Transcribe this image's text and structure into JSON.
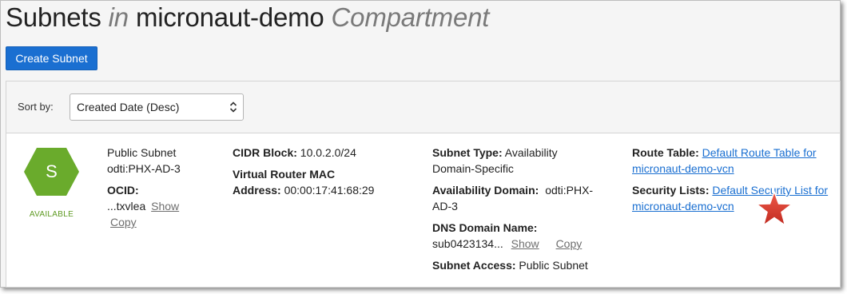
{
  "header": {
    "title_part1": "Subnets",
    "title_in": "in",
    "title_compartment_name": "micronaut-demo",
    "title_compartment_word": "Compartment"
  },
  "toolbar": {
    "create_label": "Create Subnet"
  },
  "sort": {
    "label": "Sort by:",
    "selected": "Created Date (Desc)"
  },
  "subnet": {
    "avatar_letter": "S",
    "state": "AVAILABLE",
    "name": "Public Subnet",
    "availability_domain_short": "odti:PHX-AD-3",
    "ocid_label": "OCID:",
    "ocid_value": "...txvlea",
    "show_label": "Show",
    "copy_label": "Copy",
    "cidr_label": "CIDR Block:",
    "cidr_value": "10.0.2.0/24",
    "vr_mac_label_1": "Virtual Router MAC",
    "vr_mac_label_2": "Address:",
    "vr_mac_value": "00:00:17:41:68:29",
    "subnet_type_label": "Subnet Type:",
    "subnet_type_value_1": "Availability",
    "subnet_type_value_2": "Domain-Specific",
    "ad_label": "Availability Domain:",
    "ad_value_1": "odti:PHX-",
    "ad_value_2": "AD-3",
    "dns_label": "DNS Domain Name:",
    "dns_value": "sub0423134...",
    "subnet_access_label": "Subnet Access:",
    "subnet_access_value": "Public Subnet",
    "route_table_label": "Route Table:",
    "route_table_link_1": "Default Route Table for",
    "route_table_link_2": "micronaut-demo-vcn",
    "security_lists_label": "Security Lists:",
    "security_list_link_1": "Default Security List for",
    "security_list_link_2": "micronaut-demo-vcn"
  },
  "icons": {
    "avatar": "hexagon-icon",
    "sort_chevron": "chevron-updown-icon",
    "annotation": "star-icon"
  },
  "colors": {
    "primary_button": "#1a6fd1",
    "available_green": "#6aab2c",
    "link": "#1a6fd1",
    "star": "#d63a2e"
  }
}
